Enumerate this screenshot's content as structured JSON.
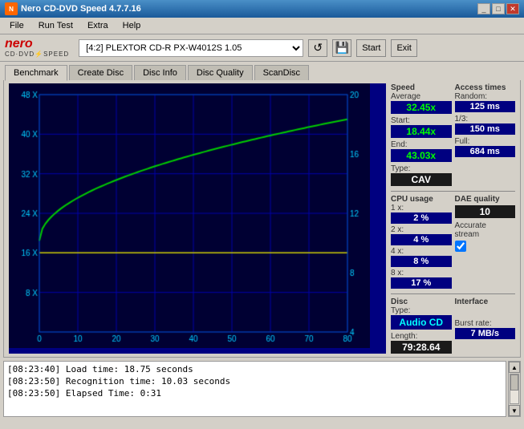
{
  "window": {
    "title": "Nero CD-DVD Speed 4.7.7.16",
    "icon": "CD"
  },
  "menu": {
    "items": [
      "File",
      "Run Test",
      "Extra",
      "Help"
    ]
  },
  "toolbar": {
    "drive_label": "[4:2]  PLEXTOR CD-R  PX-W4012S 1.05",
    "start_label": "Start",
    "exit_label": "Exit"
  },
  "tabs": {
    "items": [
      "Benchmark",
      "Create Disc",
      "Disc Info",
      "Disc Quality",
      "ScanDisc"
    ],
    "active": 0
  },
  "stats": {
    "speed_label": "Speed",
    "average_label": "Average",
    "average_value": "32.45x",
    "start_label": "Start:",
    "start_value": "18.44x",
    "end_label": "End:",
    "end_value": "43.03x",
    "type_label": "Type:",
    "type_value": "CAV",
    "dae_label": "DAE quality",
    "dae_value": "10",
    "accurate_label": "Accurate",
    "accurate_stream_label": "stream",
    "disc_label": "Disc",
    "disc_type_label": "Type:",
    "disc_type_value": "Audio CD",
    "length_label": "Length:",
    "length_value": "79:28.64"
  },
  "access_times": {
    "title": "Access times",
    "random_label": "Random:",
    "random_value": "125 ms",
    "third_label": "1/3:",
    "third_value": "150 ms",
    "full_label": "Full:",
    "full_value": "684 ms"
  },
  "cpu_usage": {
    "title": "CPU usage",
    "1x_label": "1 x:",
    "1x_value": "2 %",
    "2x_label": "2 x:",
    "2x_value": "4 %",
    "4x_label": "4 x:",
    "4x_value": "8 %",
    "8x_label": "8 x:",
    "8x_value": "17 %"
  },
  "interface": {
    "title": "Interface",
    "burst_label": "Burst rate:",
    "burst_value": "7 MB/s"
  },
  "log": {
    "entries": [
      "[08:23:40]  Load time: 18.75 seconds",
      "[08:23:50]  Recognition time: 10.03 seconds",
      "[08:23:50]  Elapsed Time: 0:31"
    ]
  },
  "chart": {
    "y_axis_left": [
      "48 X",
      "40 X",
      "32 X",
      "24 X",
      "16 X",
      "8 X"
    ],
    "y_axis_right": [
      "20",
      "16",
      "12",
      "8",
      "4"
    ],
    "x_axis": [
      "0",
      "10",
      "20",
      "30",
      "40",
      "50",
      "60",
      "70",
      "80"
    ],
    "progress_color": "#00cc00",
    "grid_color": "#0000cc"
  }
}
